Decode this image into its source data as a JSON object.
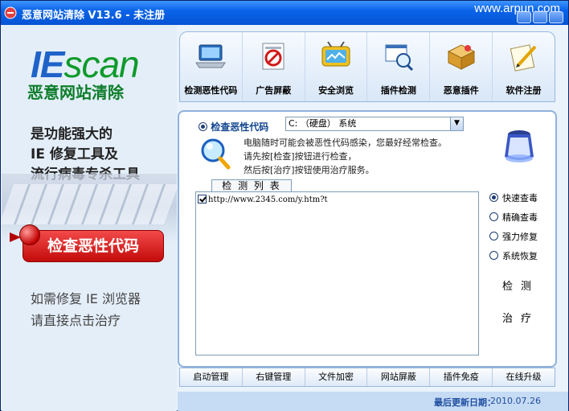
{
  "window": {
    "title": "恶意网站清除  V13.6 - 未注册",
    "watermark": "www.arpun.com"
  },
  "left": {
    "logo_prefix": "IE",
    "logo_rest": "scan",
    "logo_sub": "恶意网站清除",
    "slogan_lines": [
      "是功能强大的",
      "IE 修复工具及",
      "流行病毒专杀工具"
    ],
    "action_button": "检查恶性代码",
    "hint_lines": [
      "如需修复 IE 浏览器",
      "请直接点击治疗"
    ]
  },
  "toolbar": {
    "items": [
      {
        "label": "检测恶性代码",
        "icon": "laptop-scan-icon"
      },
      {
        "label": "广告屏蔽",
        "icon": "ad-block-icon"
      },
      {
        "label": "安全浏览",
        "icon": "safe-browse-icon"
      },
      {
        "label": "插件检测",
        "icon": "plugin-detect-icon"
      },
      {
        "label": "恶意插件",
        "icon": "malicious-plugin-icon"
      },
      {
        "label": "软件注册",
        "icon": "register-icon"
      }
    ]
  },
  "main": {
    "radio_label": "检查恶性代码",
    "drive_select": "C: （硬盘） 系统",
    "info_lines": [
      "电脑随时可能会被恶性代码感染，您最好经常检查。",
      "请先按[检查]按钮进行检查，",
      "然后按[治疗]按钮使用治疗服务。"
    ],
    "list_title": "检 测 列 表",
    "list_items": [
      "http://www.2345.com/y.htm?t"
    ],
    "options": [
      {
        "label": "快速查毒",
        "selected": true
      },
      {
        "label": "精确查毒",
        "selected": false
      },
      {
        "label": "强力修复",
        "selected": false
      },
      {
        "label": "系统恢复",
        "selected": false
      }
    ],
    "detect_button": "检测",
    "treat_button": "治疗"
  },
  "bottom": {
    "buttons": [
      "启动管理",
      "右键管理",
      "文件加密",
      "网站屏蔽",
      "插件免疫",
      "在线升级"
    ]
  },
  "status": {
    "label": "最后更新日期：",
    "date": "2010.07.26"
  }
}
